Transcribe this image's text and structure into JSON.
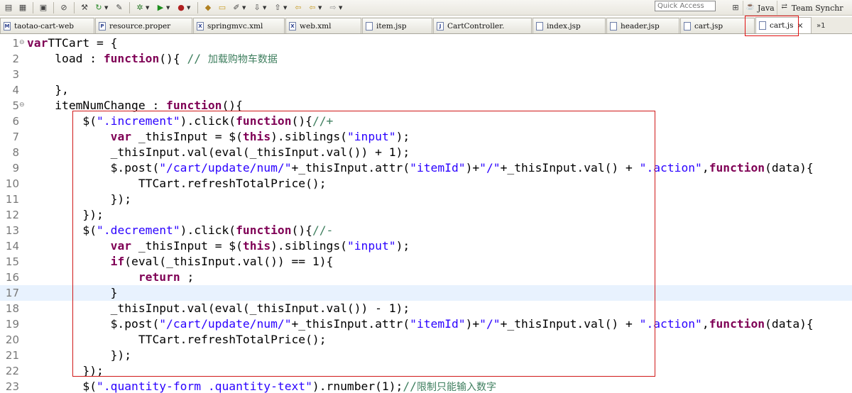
{
  "toolbar": {
    "quick_access_placeholder": "Quick Access",
    "perspectives": [
      {
        "label": "Java",
        "icon": "java-perspective-icon"
      },
      {
        "label": "Team Synchr",
        "icon": "team-sync-icon"
      }
    ]
  },
  "tabs": [
    {
      "label": "taotao-cart-web",
      "icon": "M",
      "active": false
    },
    {
      "label": "resource.proper",
      "icon": "P",
      "active": false
    },
    {
      "label": "springmvc.xml",
      "icon": "X",
      "active": false
    },
    {
      "label": "web.xml",
      "icon": "X",
      "active": false
    },
    {
      "label": "item.jsp",
      "icon": "",
      "active": false
    },
    {
      "label": "CartController.",
      "icon": "J",
      "active": false
    },
    {
      "label": "index.jsp",
      "icon": "",
      "active": false
    },
    {
      "label": "header.jsp",
      "icon": "",
      "active": false
    },
    {
      "label": "cart.jsp",
      "icon": "",
      "active": false
    },
    {
      "label": "cart.js",
      "icon": "",
      "active": true,
      "close": "✕"
    }
  ],
  "tab_overflow": "»1",
  "editor": {
    "current_line": 17,
    "lines": [
      {
        "n": "1",
        "fold": "⊖",
        "parts": [
          [
            "kw",
            "var"
          ],
          [
            "",
            "TTCart = {"
          ]
        ]
      },
      {
        "n": "2",
        "fold": "",
        "parts": [
          [
            "",
            "    load : "
          ],
          [
            "kw",
            "function"
          ],
          [
            "",
            "(){ "
          ],
          [
            "cm",
            "// "
          ],
          [
            "cm cm-cjk",
            "加载购物车数据"
          ]
        ]
      },
      {
        "n": "3",
        "fold": "",
        "parts": [
          [
            "",
            ""
          ]
        ]
      },
      {
        "n": "4",
        "fold": "",
        "parts": [
          [
            "",
            "    },"
          ]
        ]
      },
      {
        "n": "5",
        "fold": "⊖",
        "parts": [
          [
            "",
            "    itemNumChange : "
          ],
          [
            "kw",
            "function"
          ],
          [
            "",
            "(){"
          ]
        ]
      },
      {
        "n": "6",
        "fold": "",
        "parts": [
          [
            "",
            "        $("
          ],
          [
            "str",
            "\".increment\""
          ],
          [
            "",
            ").click("
          ],
          [
            "kw",
            "function"
          ],
          [
            "",
            "(){"
          ],
          [
            "cm",
            "//+"
          ]
        ]
      },
      {
        "n": "7",
        "fold": "",
        "parts": [
          [
            "",
            "            "
          ],
          [
            "kw",
            "var"
          ],
          [
            "",
            " _thisInput = $("
          ],
          [
            "kw",
            "this"
          ],
          [
            "",
            ").siblings("
          ],
          [
            "str",
            "\"input\""
          ],
          [
            "",
            ");"
          ]
        ]
      },
      {
        "n": "8",
        "fold": "",
        "parts": [
          [
            "",
            "            _thisInput.val(eval(_thisInput.val()) + 1);"
          ]
        ]
      },
      {
        "n": "9",
        "fold": "",
        "parts": [
          [
            "",
            "            $.post("
          ],
          [
            "str",
            "\"/cart/update/num/\""
          ],
          [
            "",
            "+_thisInput.attr("
          ],
          [
            "str",
            "\"itemId\""
          ],
          [
            "",
            ")+"
          ],
          [
            "str",
            "\"/\""
          ],
          [
            "",
            "+_thisInput.val() + "
          ],
          [
            "str",
            "\".action\""
          ],
          [
            "",
            ","
          ],
          [
            "kw",
            "function"
          ],
          [
            "",
            "(data){"
          ]
        ]
      },
      {
        "n": "10",
        "fold": "",
        "parts": [
          [
            "",
            "                TTCart.refreshTotalPrice();"
          ]
        ]
      },
      {
        "n": "11",
        "fold": "",
        "parts": [
          [
            "",
            "            });"
          ]
        ]
      },
      {
        "n": "12",
        "fold": "",
        "parts": [
          [
            "",
            "        });"
          ]
        ]
      },
      {
        "n": "13",
        "fold": "",
        "parts": [
          [
            "",
            "        $("
          ],
          [
            "str",
            "\".decrement\""
          ],
          [
            "",
            ").click("
          ],
          [
            "kw",
            "function"
          ],
          [
            "",
            "(){"
          ],
          [
            "cm",
            "//-"
          ]
        ]
      },
      {
        "n": "14",
        "fold": "",
        "parts": [
          [
            "",
            "            "
          ],
          [
            "kw",
            "var"
          ],
          [
            "",
            " _thisInput = $("
          ],
          [
            "kw",
            "this"
          ],
          [
            "",
            ").siblings("
          ],
          [
            "str",
            "\"input\""
          ],
          [
            "",
            ");"
          ]
        ]
      },
      {
        "n": "15",
        "fold": "",
        "parts": [
          [
            "",
            "            "
          ],
          [
            "kw",
            "if"
          ],
          [
            "",
            "(eval(_thisInput.val()) == 1){"
          ]
        ]
      },
      {
        "n": "16",
        "fold": "",
        "parts": [
          [
            "",
            "                "
          ],
          [
            "kw",
            "return"
          ],
          [
            "",
            " ;"
          ]
        ]
      },
      {
        "n": "17",
        "fold": "",
        "parts": [
          [
            "",
            "            }"
          ]
        ]
      },
      {
        "n": "18",
        "fold": "",
        "parts": [
          [
            "",
            "            _thisInput.val(eval(_thisInput.val()) - 1);"
          ]
        ]
      },
      {
        "n": "19",
        "fold": "",
        "parts": [
          [
            "",
            "            $.post("
          ],
          [
            "str",
            "\"/cart/update/num/\""
          ],
          [
            "",
            "+_thisInput.attr("
          ],
          [
            "str",
            "\"itemId\""
          ],
          [
            "",
            ")+"
          ],
          [
            "str",
            "\"/\""
          ],
          [
            "",
            "+_thisInput.val() + "
          ],
          [
            "str",
            "\".action\""
          ],
          [
            "",
            ","
          ],
          [
            "kw",
            "function"
          ],
          [
            "",
            "(data){"
          ]
        ]
      },
      {
        "n": "20",
        "fold": "",
        "parts": [
          [
            "",
            "                TTCart.refreshTotalPrice();"
          ]
        ]
      },
      {
        "n": "21",
        "fold": "",
        "parts": [
          [
            "",
            "            });"
          ]
        ]
      },
      {
        "n": "22",
        "fold": "",
        "parts": [
          [
            "",
            "        });"
          ]
        ]
      },
      {
        "n": "23",
        "fold": "",
        "parts": [
          [
            "",
            "        $("
          ],
          [
            "str",
            "\".quantity-form .quantity-text\""
          ],
          [
            "",
            ").rnumber(1);"
          ],
          [
            "cm",
            "//"
          ],
          [
            "cm cm-cjk",
            "限制只能输入数字"
          ]
        ]
      }
    ]
  },
  "colors": {
    "keyword": "#7f0055",
    "string": "#2a00ff",
    "comment": "#3f7f5f",
    "highlight_border": "#d01818",
    "current_line": "#e8f2fe"
  }
}
